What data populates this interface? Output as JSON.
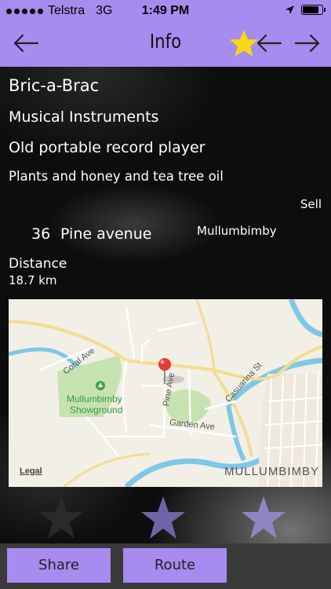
{
  "status_bar": {
    "carrier": "Telstra",
    "network": "3G",
    "time": "1:49 PM",
    "battery_level": 0.85
  },
  "nav": {
    "title": "Info",
    "icons": [
      "back-arrow-icon",
      "favorite-star-icon",
      "prev-arrow-icon",
      "next-arrow-icon"
    ],
    "accent_color": "#a78bef",
    "star_color": "#f7d913"
  },
  "listing": {
    "name": "Bric-a-Brac",
    "category": "Musical Instruments",
    "item": "Old portable record player",
    "description": "Plants and honey and tea tree oil",
    "type": "Sell",
    "address_number": "36",
    "address_street": "Pine avenue",
    "suburb": "Mullumbimby",
    "distance_label": "Distance",
    "distance_value": "18.7 km"
  },
  "map": {
    "legal": "Legal",
    "town_label": "MULLUMBIMBY",
    "street_labels": {
      "coral_ave": "Coral Ave",
      "pine_ave": "Pine Ave",
      "garden_ave": "Garden Ave",
      "casuarina_st": "Casuarina St",
      "showground_line1": "Mullumbimby",
      "showground_line2": "Showground"
    }
  },
  "rating": {
    "max": 3,
    "value": 0
  },
  "buttons": {
    "share": "Share",
    "route": "Route"
  }
}
